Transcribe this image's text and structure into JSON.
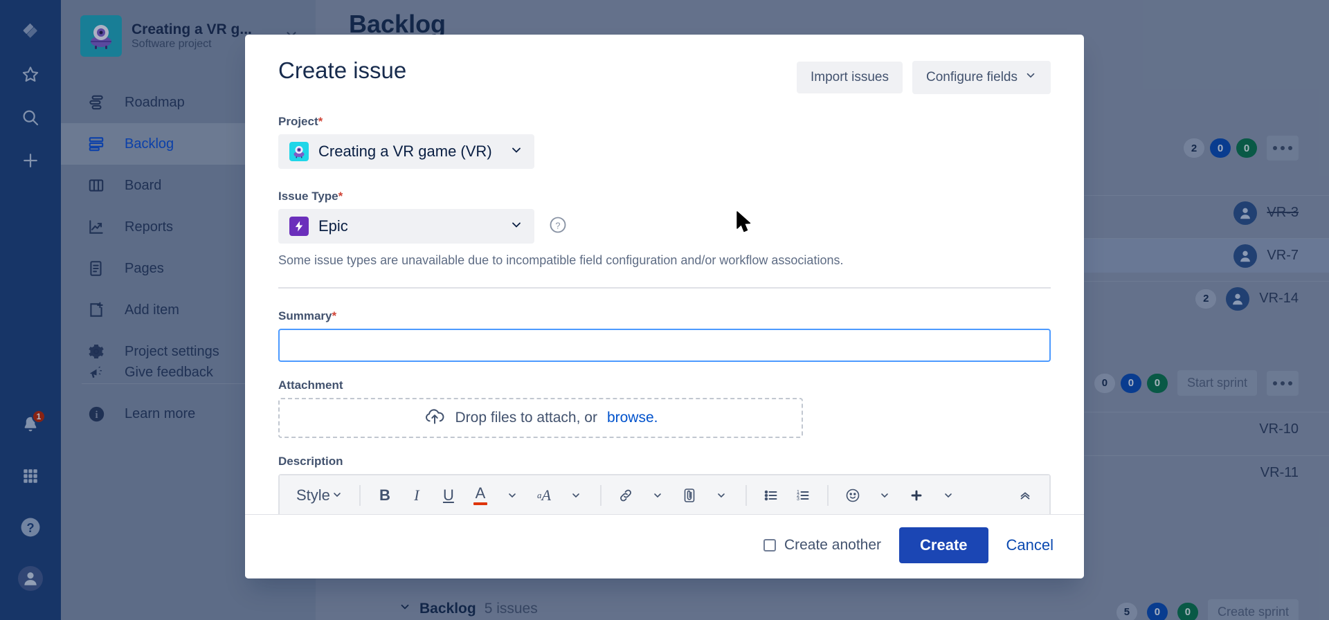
{
  "rail": {
    "items": [
      {
        "name": "jira-logo",
        "icon": "jira-logo-icon"
      },
      {
        "name": "starred",
        "icon": "star-icon"
      },
      {
        "name": "search",
        "icon": "search-icon"
      },
      {
        "name": "create",
        "icon": "plus-icon"
      }
    ],
    "bottom": [
      {
        "name": "notifications",
        "icon": "bell-icon",
        "badge": "1"
      },
      {
        "name": "app-switcher",
        "icon": "grid-icon"
      },
      {
        "name": "help",
        "icon": "question-circle-icon"
      },
      {
        "name": "profile",
        "icon": "avatar-icon"
      }
    ]
  },
  "sidebar": {
    "project_name": "Creating a VR g...",
    "project_type": "Software project",
    "items": [
      {
        "label": "Roadmap",
        "icon": "roadmap-icon",
        "active": false
      },
      {
        "label": "Backlog",
        "icon": "backlog-icon",
        "active": true
      },
      {
        "label": "Board",
        "icon": "board-icon",
        "active": false
      },
      {
        "label": "Reports",
        "icon": "reports-icon",
        "active": false
      },
      {
        "label": "Pages",
        "icon": "pages-icon",
        "active": false
      },
      {
        "label": "Add item",
        "icon": "add-item-icon",
        "active": false
      },
      {
        "label": "Project settings",
        "icon": "gear-icon",
        "active": false
      }
    ],
    "bottom_items": [
      {
        "label": "Give feedback",
        "icon": "megaphone-icon"
      },
      {
        "label": "Learn more",
        "icon": "info-icon"
      }
    ]
  },
  "backlog": {
    "page_title": "Backlog",
    "sprint_badges": [
      "2",
      "0",
      "0"
    ],
    "issues": [
      {
        "key": "VR-3",
        "done": true,
        "count": "",
        "selected": false
      },
      {
        "key": "VR-7",
        "done": false,
        "count": "",
        "selected": true
      },
      {
        "key": "VR-14",
        "done": false,
        "count": "2",
        "selected": false
      }
    ],
    "sprint2_badges": [
      "0",
      "0",
      "0"
    ],
    "start_sprint_label": "Start sprint",
    "sprint2_issues": [
      {
        "key": "VR-10"
      },
      {
        "key": "VR-11"
      }
    ],
    "backlog_section": {
      "label": "Backlog",
      "count": "5 issues"
    },
    "backlog_badges": [
      "5",
      "0",
      "0"
    ],
    "create_sprint_label": "Create sprint"
  },
  "modal": {
    "title": "Create issue",
    "import_issues_label": "Import issues",
    "configure_fields_label": "Configure fields",
    "project": {
      "label": "Project",
      "required": "*",
      "value": "Creating a VR game (VR)",
      "icon": "project-avatar-icon"
    },
    "issue_type": {
      "label": "Issue Type",
      "required": "*",
      "value": "Epic",
      "icon": "epic-icon",
      "help_icon": "question-circle-icon",
      "note": "Some issue types are unavailable due to incompatible field configuration and/or workflow associations."
    },
    "summary": {
      "label": "Summary",
      "required": "*",
      "value": "",
      "placeholder": ""
    },
    "attachment": {
      "label": "Attachment",
      "drop_text": "Drop files to attach, or",
      "browse_label": "browse.",
      "icon": "cloud-upload-icon"
    },
    "description": {
      "label": "Description",
      "toolbar": [
        {
          "name": "style-dropdown",
          "label": "Style",
          "icon": "chevron-down-icon"
        },
        {
          "name": "bold-button",
          "label": "B",
          "icon": "bold-icon"
        },
        {
          "name": "italic-button",
          "label": "I",
          "icon": "italic-icon"
        },
        {
          "name": "underline-button",
          "label": "U",
          "icon": "underline-icon"
        },
        {
          "name": "text-color-button",
          "label": "A",
          "icon": "text-color-icon"
        },
        {
          "name": "text-style-button",
          "label": "aA",
          "icon": "more-text-styles-icon"
        },
        {
          "name": "link-button",
          "label": "",
          "icon": "link-icon"
        },
        {
          "name": "attach-button",
          "label": "",
          "icon": "paperclip-icon"
        },
        {
          "name": "bullet-list-button",
          "label": "",
          "icon": "bullet-list-icon"
        },
        {
          "name": "numbered-list-button",
          "label": "",
          "icon": "numbered-list-icon"
        },
        {
          "name": "emoji-button",
          "label": "",
          "icon": "emoji-icon"
        },
        {
          "name": "insert-more-button",
          "label": "",
          "icon": "plus-icon"
        },
        {
          "name": "collapse-toolbar-button",
          "label": "",
          "icon": "chevron-double-up-icon"
        }
      ]
    },
    "footer": {
      "create_another_label": "Create another",
      "create_label": "Create",
      "cancel_label": "Cancel"
    }
  },
  "colors": {
    "primary": "#1b46b4",
    "link": "#0052cc",
    "required": "#d04437",
    "focus_border": "#4c9aff",
    "epic_purple": "#6b2fbb",
    "project_teal": "#1fa8bb",
    "rail_navy": "#1d3f78",
    "badge_red": "#bf2600",
    "badge_blue": "#0a49b0",
    "badge_green": "#0a7348"
  }
}
